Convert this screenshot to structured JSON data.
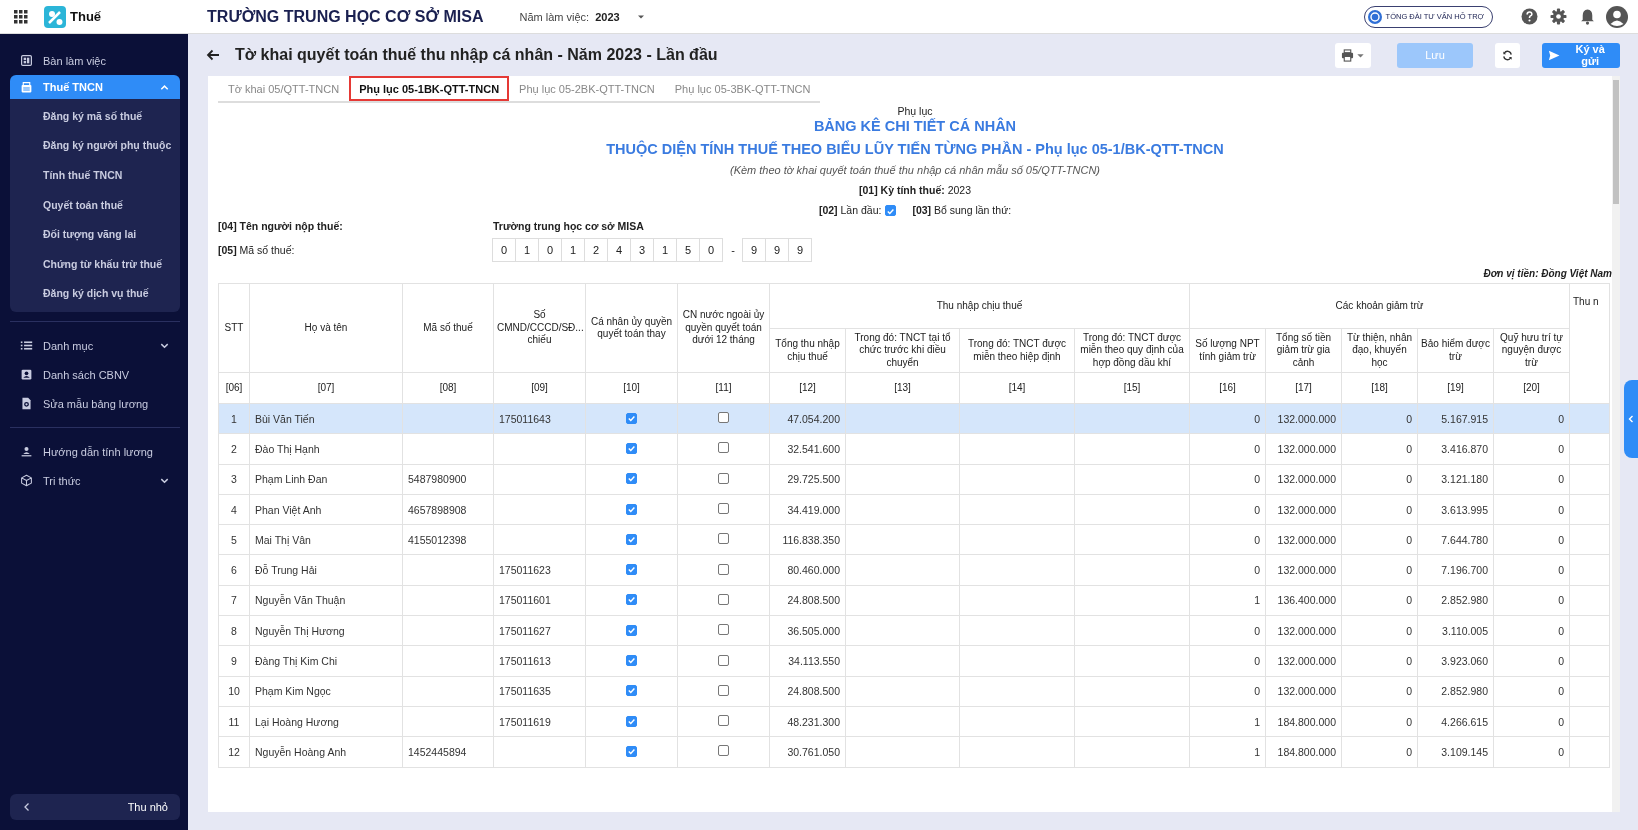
{
  "header": {
    "app_name": "Thuế",
    "organization": "TRƯỜNG TRUNG HỌC CƠ SỞ MISA",
    "year_label": "Năm làm việc:",
    "year": "2023",
    "hotline": "TỔNG ĐÀI TƯ VẤN HỖ TRỢ"
  },
  "sidebar": {
    "sections": [
      [
        {
          "label": "Bàn làm việc",
          "selected": false
        },
        {
          "label": "Thuế TNCN",
          "selected": true,
          "expanded": true,
          "children": [
            {
              "label": "Đăng ký mã số thuế",
              "selected": false
            },
            {
              "label": "Đăng ký người phụ thuộc",
              "selected": false
            },
            {
              "label": "Tính thuế TNCN",
              "selected": false
            },
            {
              "label": "Quyết toán thuế",
              "selected": false
            },
            {
              "label": "Đối tượng vãng lai",
              "selected": false
            },
            {
              "label": "Chứng từ khấu trừ thuế",
              "selected": false
            },
            {
              "label": "Đăng ký dịch vụ thuế",
              "selected": false
            }
          ]
        }
      ],
      [
        {
          "label": "Danh mục",
          "selected": false,
          "expanded": false
        },
        {
          "label": "Danh sách CBNV",
          "selected": false
        },
        {
          "label": "Sửa mẫu bảng lương",
          "selected": false
        }
      ],
      [
        {
          "label": "Hướng dẫn tính lương",
          "selected": false
        },
        {
          "label": "Tri thức",
          "selected": false,
          "expanded": false
        }
      ]
    ],
    "collapse": "Thu nhỏ"
  },
  "page": {
    "title": "Tờ khai quyết toán thuế thu nhập cá nhân - Năm 2023 - Lần đầu",
    "save": {
      "label": "Lưu",
      "disabled": true
    },
    "send": "Ký và gửi"
  },
  "tabs": [
    {
      "label": "Tờ khai 05/QTT-TNCN",
      "selected": false
    },
    {
      "label": "Phụ lục 05-1BK-QTT-TNCN",
      "selected": true
    },
    {
      "label": "Phụ lục 05-2BK-QTT-TNCN",
      "selected": false
    },
    {
      "label": "Phụ lục 05-3BK-QTT-TNCN",
      "selected": false
    }
  ],
  "form": {
    "appendix_label": "Phụ lục",
    "title": "BẢNG KÊ CHI TIẾT CÁ NHÂN",
    "subtitle": "THUỘC DIỆN TÍNH THUẾ THEO BIỂU LŨY TIẾN TỪNG PHẦN - Phụ lục 05-1/BK-QTT-TNCN",
    "note": "(Kèm theo tờ khai quyết toán thuế thu nhập cá nhân mẫu số 05/QTT-TNCN)",
    "period": "**[01] Kỳ tính thuế:** 2023",
    "first_time": {
      "label": "**[02]** Lần đầu:",
      "checked": true
    },
    "supplement": {
      "label": "**[03]** Bổ sung lần thứ:"
    },
    "taxpayer": {
      "label": "[04] Tên người nộp thuế:",
      "value": "Trường trung học cơ sở MISA"
    },
    "tax_code": {
      "label": "**[05]** Mã số thuế:",
      "digits": [
        "0",
        "1",
        "0",
        "1",
        "2",
        "4",
        "3",
        "1",
        "5",
        "0"
      ],
      "separator": "-",
      "suffix_digits": [
        "9",
        "9",
        "9"
      ]
    },
    "currency_note": "Đơn vị tiền: Đồng Việt Nam"
  },
  "table": {
    "columns": [
      {
        "label": "STT",
        "code": "[06]"
      },
      {
        "label": "Họ và tên",
        "code": "[07]"
      },
      {
        "label": "Mã số thuế",
        "code": "[08]"
      },
      {
        "label": "Số CMND/CCCD/SĐ... chiếu",
        "code": "[09]"
      },
      {
        "label": "Cá nhân ủy quyền quyết toán thay",
        "code": "[10]"
      },
      {
        "label": "CN nước ngoài ủy quyền quyết toán dưới 12 tháng",
        "code": "[11]"
      },
      {
        "group": "Thu nhập chịu thuế",
        "children": [
          {
            "label": "Tổng thu nhập chịu thuế",
            "code": "[12]"
          },
          {
            "label": "Trong đó: TNCT tại tổ chức trước khi điều chuyển",
            "code": "[13]"
          },
          {
            "label": "Trong đó: TNCT được miễn theo hiệp định",
            "code": "[14]"
          },
          {
            "label": "Trong đó: TNCT được miễn theo quy định của hợp đồng dầu khí",
            "code": "[15]"
          }
        ]
      },
      {
        "group": "Các khoản giảm trừ",
        "children": [
          {
            "label": "Số lượng NPT tính giảm trừ",
            "code": "[16]"
          },
          {
            "label": "Tổng số tiền giảm trừ gia cảnh",
            "code": "[17]"
          },
          {
            "label": "Từ thiện, nhân đạo, khuyến học",
            "code": "[18]"
          },
          {
            "label": "Bảo hiểm được trừ",
            "code": "[19]"
          },
          {
            "label": "Quỹ hưu trí tự nguyện được trừ",
            "code": "[20]"
          }
        ]
      },
      {
        "label": "Thu n"
      }
    ],
    "rows": [
      {
        "selected": true,
        "stt": "1",
        "name": "Bùi Văn Tiến",
        "id_number": "175011643",
        "authorized": true,
        "foreign_resident": false,
        "taxable_income": "47.054.200",
        "dependents": "0",
        "family_deduction": "132.000.000",
        "charity": "0",
        "insurance": "5.167.915",
        "pension_fund": "0"
      },
      {
        "selected": false,
        "stt": "2",
        "name": "Đào Thị Hạnh",
        "authorized": true,
        "foreign_resident": false,
        "taxable_income": "32.541.600",
        "dependents": "0",
        "family_deduction": "132.000.000",
        "charity": "0",
        "insurance": "3.416.870",
        "pension_fund": "0"
      },
      {
        "selected": false,
        "stt": "3",
        "name": "Phạm Linh Đan",
        "tax_code": "5487980900",
        "authorized": true,
        "foreign_resident": false,
        "taxable_income": "29.725.500",
        "dependents": "0",
        "family_deduction": "132.000.000",
        "charity": "0",
        "insurance": "3.121.180",
        "pension_fund": "0"
      },
      {
        "selected": false,
        "stt": "4",
        "name": "Phan Việt Anh",
        "tax_code": "4657898908",
        "authorized": true,
        "foreign_resident": false,
        "taxable_income": "34.419.000",
        "dependents": "0",
        "family_deduction": "132.000.000",
        "charity": "0",
        "insurance": "3.613.995",
        "pension_fund": "0"
      },
      {
        "selected": false,
        "stt": "5",
        "name": "Mai Thị Vân",
        "tax_code": "4155012398",
        "authorized": true,
        "foreign_resident": false,
        "taxable_income": "116.838.350",
        "dependents": "0",
        "family_deduction": "132.000.000",
        "charity": "0",
        "insurance": "7.644.780",
        "pension_fund": "0"
      },
      {
        "selected": false,
        "stt": "6",
        "name": "Đỗ Trung Hải",
        "id_number": "175011623",
        "authorized": true,
        "foreign_resident": false,
        "taxable_income": "80.460.000",
        "dependents": "0",
        "family_deduction": "132.000.000",
        "charity": "0",
        "insurance": "7.196.700",
        "pension_fund": "0"
      },
      {
        "selected": false,
        "stt": "7",
        "name": "Nguyễn Văn Thuận",
        "id_number": "175011601",
        "authorized": true,
        "foreign_resident": false,
        "taxable_income": "24.808.500",
        "dependents": "1",
        "family_deduction": "136.400.000",
        "charity": "0",
        "insurance": "2.852.980",
        "pension_fund": "0"
      },
      {
        "selected": false,
        "stt": "8",
        "name": "Nguyễn Thị Hương",
        "id_number": "175011627",
        "authorized": true,
        "foreign_resident": false,
        "taxable_income": "36.505.000",
        "dependents": "0",
        "family_deduction": "132.000.000",
        "charity": "0",
        "insurance": "3.110.005",
        "pension_fund": "0"
      },
      {
        "selected": false,
        "stt": "9",
        "name": "Đàng Thị Kim Chi",
        "id_number": "175011613",
        "authorized": true,
        "foreign_resident": false,
        "taxable_income": "34.113.550",
        "dependents": "0",
        "family_deduction": "132.000.000",
        "charity": "0",
        "insurance": "3.923.060",
        "pension_fund": "0"
      },
      {
        "selected": false,
        "stt": "10",
        "name": "Phạm Kim Ngọc",
        "id_number": "175011635",
        "authorized": true,
        "foreign_resident": false,
        "taxable_income": "24.808.500",
        "dependents": "0",
        "family_deduction": "132.000.000",
        "charity": "0",
        "insurance": "2.852.980",
        "pension_fund": "0"
      },
      {
        "selected": false,
        "stt": "11",
        "name": "Lại Hoàng Hương",
        "id_number": "175011619",
        "authorized": true,
        "foreign_resident": false,
        "taxable_income": "48.231.300",
        "dependents": "1",
        "family_deduction": "184.800.000",
        "charity": "0",
        "insurance": "4.266.615",
        "pension_fund": "0"
      },
      {
        "selected": false,
        "stt": "12",
        "name": "Nguyễn Hoàng Anh",
        "tax_code": "1452445894",
        "authorized": true,
        "foreign_resident": false,
        "taxable_income": "30.761.050",
        "dependents": "1",
        "family_deduction": "184.800.000",
        "charity": "0",
        "insurance": "3.109.145",
        "pension_fund": "0"
      }
    ]
  }
}
